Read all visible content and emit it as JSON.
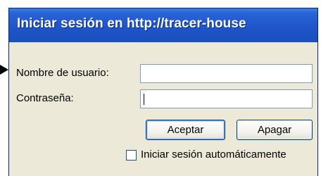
{
  "dialog": {
    "title": "Iniciar sesión en http://tracer-house"
  },
  "form": {
    "username_label": "Nombre de usuario:",
    "username_value": "",
    "password_label": "Contraseña:",
    "password_value": ""
  },
  "buttons": {
    "accept_label": "Aceptar",
    "shutdown_label": "Apagar"
  },
  "auto_login": {
    "label": "Iniciar sesión automáticamente",
    "checked": false
  },
  "colors": {
    "title_bar": "#2a63d6",
    "dialog_bg": "#ece9d8",
    "field_border": "#7f9db9"
  }
}
